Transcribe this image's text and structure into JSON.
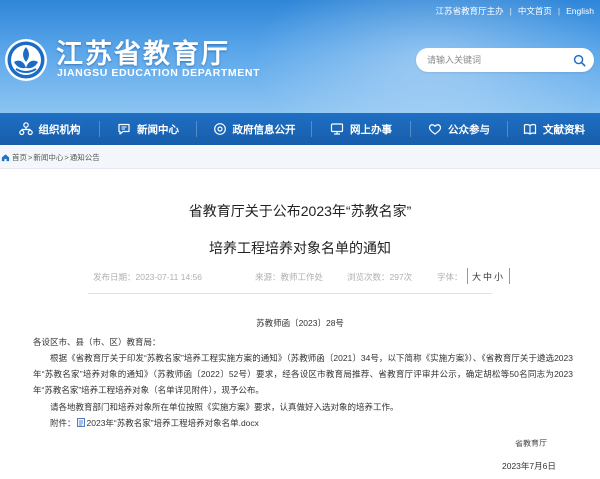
{
  "header": {
    "top_links": [
      "江苏省教育厅主办",
      "中文首页",
      "English"
    ],
    "title_cn": "江苏省教育厅",
    "title_en": "JIANGSU EDUCATION DEPARTMENT",
    "search_placeholder": "请输入关键词",
    "colors": {
      "header_top": "#2f86d8",
      "header_bottom": "#8cc4f2",
      "nav": "#1f6fc4"
    }
  },
  "nav": {
    "items": [
      {
        "label": "组织机构",
        "icon": "org-chart-icon"
      },
      {
        "label": "新闻中心",
        "icon": "chat-bubble-icon"
      },
      {
        "label": "政府信息公开",
        "icon": "info-gear-icon"
      },
      {
        "label": "网上办事",
        "icon": "monitor-icon"
      },
      {
        "label": "公众参与",
        "icon": "heart-icon"
      },
      {
        "label": "文献资料",
        "icon": "book-icon"
      }
    ]
  },
  "breadcrumb": {
    "items": [
      "首页",
      "新闻中心",
      "通知公告"
    ],
    "separator": ">"
  },
  "article": {
    "title_line1": "省教育厅关于公布2023年“苏教名家”",
    "title_line2": "培养工程培养对象名单的通知",
    "meta": {
      "date": "发布日期：2023-07-11 14:56",
      "source": "来源：教师工作处",
      "views": "浏览次数：297次",
      "font_label": "字体：",
      "font_sizes": [
        "大",
        "中",
        "小"
      ]
    },
    "doc_number": "苏教师函〔2023〕28号",
    "addressee": "各设区市、县（市、区）教育局：",
    "paragraph_main": "根据《省教育厅关于印发“苏教名家”培养工程实施方案的通知》（苏教师函〔2021〕34号，以下简称《实施方案》）、《省教育厅关于遴选2023年“苏教名家”培养对象的通知》（苏教师函〔2022〕52号）要求，经各设区市教育局推荐、省教育厅评审并公示，确定胡松等50名同志为2023年“苏教名家”培养工程培养对象（名单详见附件），现予公布。",
    "paragraph_requirement": "请各地教育部门和培养对象所在单位按照《实施方案》要求，认真做好入选对象的培养工作。",
    "attachment_label": "附件：",
    "attachment_file": "2023年“苏教名家”培养工程培养对象名单.docx",
    "signature": "省教育厅",
    "sign_date": "2023年7月6日"
  }
}
